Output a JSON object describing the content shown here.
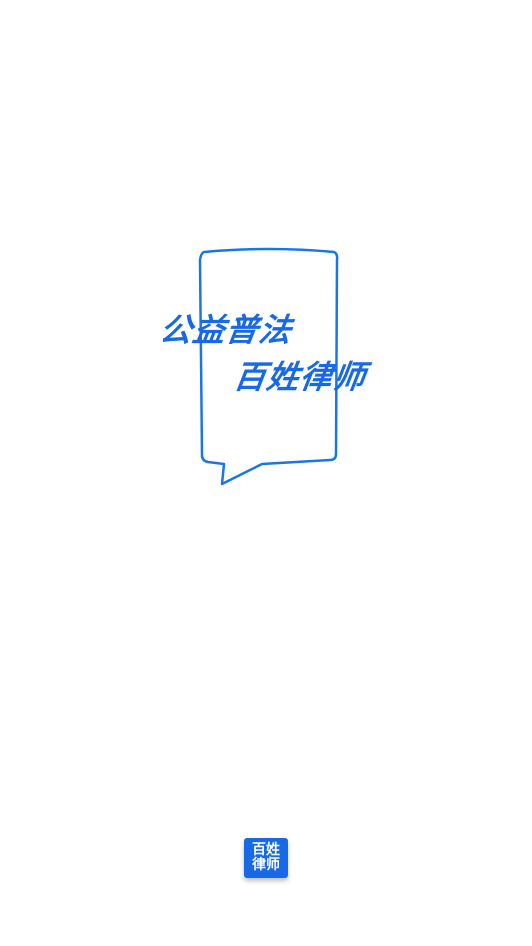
{
  "splash": {
    "slogan_line1": "公益普法",
    "slogan_line2": "百姓律师",
    "accent_color": "#1769e6",
    "bubble_icon": "speech-bubble-icon"
  },
  "logo": {
    "line1": "百姓",
    "line2": "律师"
  }
}
